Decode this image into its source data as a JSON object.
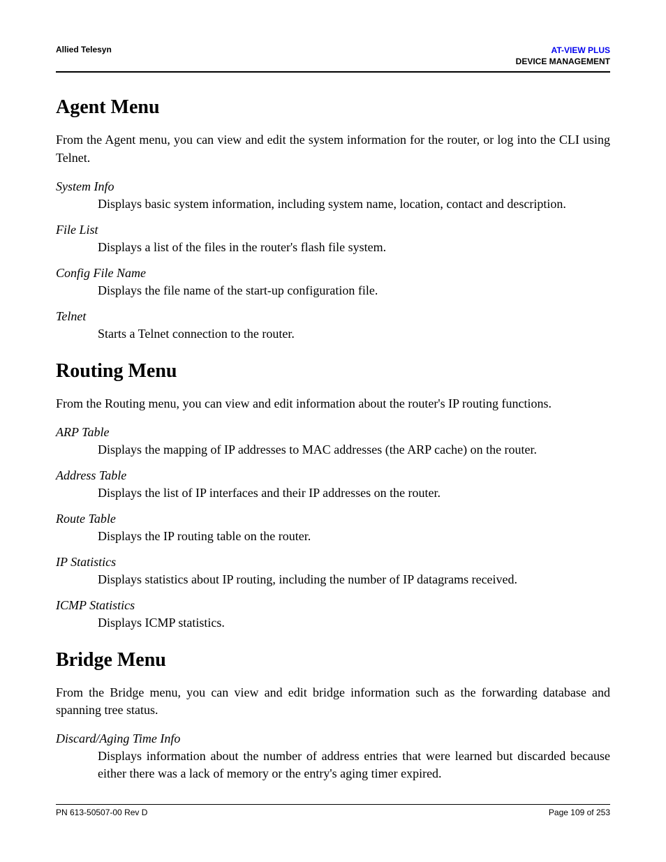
{
  "header": {
    "left": "Allied Telesyn",
    "right_line1": "AT-VIEW PLUS",
    "right_line2": "DEVICE MANAGEMENT"
  },
  "sections": [
    {
      "title": "Agent Menu",
      "intro": "From the Agent menu, you can view and edit the system information for the router, or log into the CLI using Telnet.",
      "items": [
        {
          "term": "System Info",
          "desc": "Displays basic system information, including system name, location, contact and description."
        },
        {
          "term": "File List",
          "desc": "Displays a list of the files in the router's flash file system."
        },
        {
          "term": "Config File Name",
          "desc": "Displays the file name of the start-up configuration file."
        },
        {
          "term": "Telnet",
          "desc": "Starts a Telnet connection to the router."
        }
      ]
    },
    {
      "title": "Routing Menu",
      "intro": "From the Routing menu, you can view and edit information about the router's IP routing functions.",
      "items": [
        {
          "term": "ARP Table",
          "desc": "Displays the mapping of IP addresses to MAC addresses (the ARP cache) on the router."
        },
        {
          "term": "Address Table",
          "desc": "Displays the list of IP interfaces and their IP addresses on the router."
        },
        {
          "term": "Route Table",
          "desc": "Displays the IP routing table on the router."
        },
        {
          "term": "IP Statistics",
          "desc": "Displays statistics about IP routing, including the number of IP datagrams received."
        },
        {
          "term": "ICMP Statistics",
          "desc": "Displays ICMP statistics."
        }
      ]
    },
    {
      "title": "Bridge Menu",
      "intro": "From the Bridge menu, you can view and edit bridge information such as the forwarding database and spanning tree status.",
      "items": [
        {
          "term": "Discard/Aging Time Info",
          "desc": "Displays information about the number of address entries that were learned but discarded because either there was a lack of memory or the entry's aging timer expired."
        }
      ]
    }
  ],
  "footer": {
    "left": "PN 613-50507-00 Rev D",
    "right": "Page 109 of 253"
  }
}
